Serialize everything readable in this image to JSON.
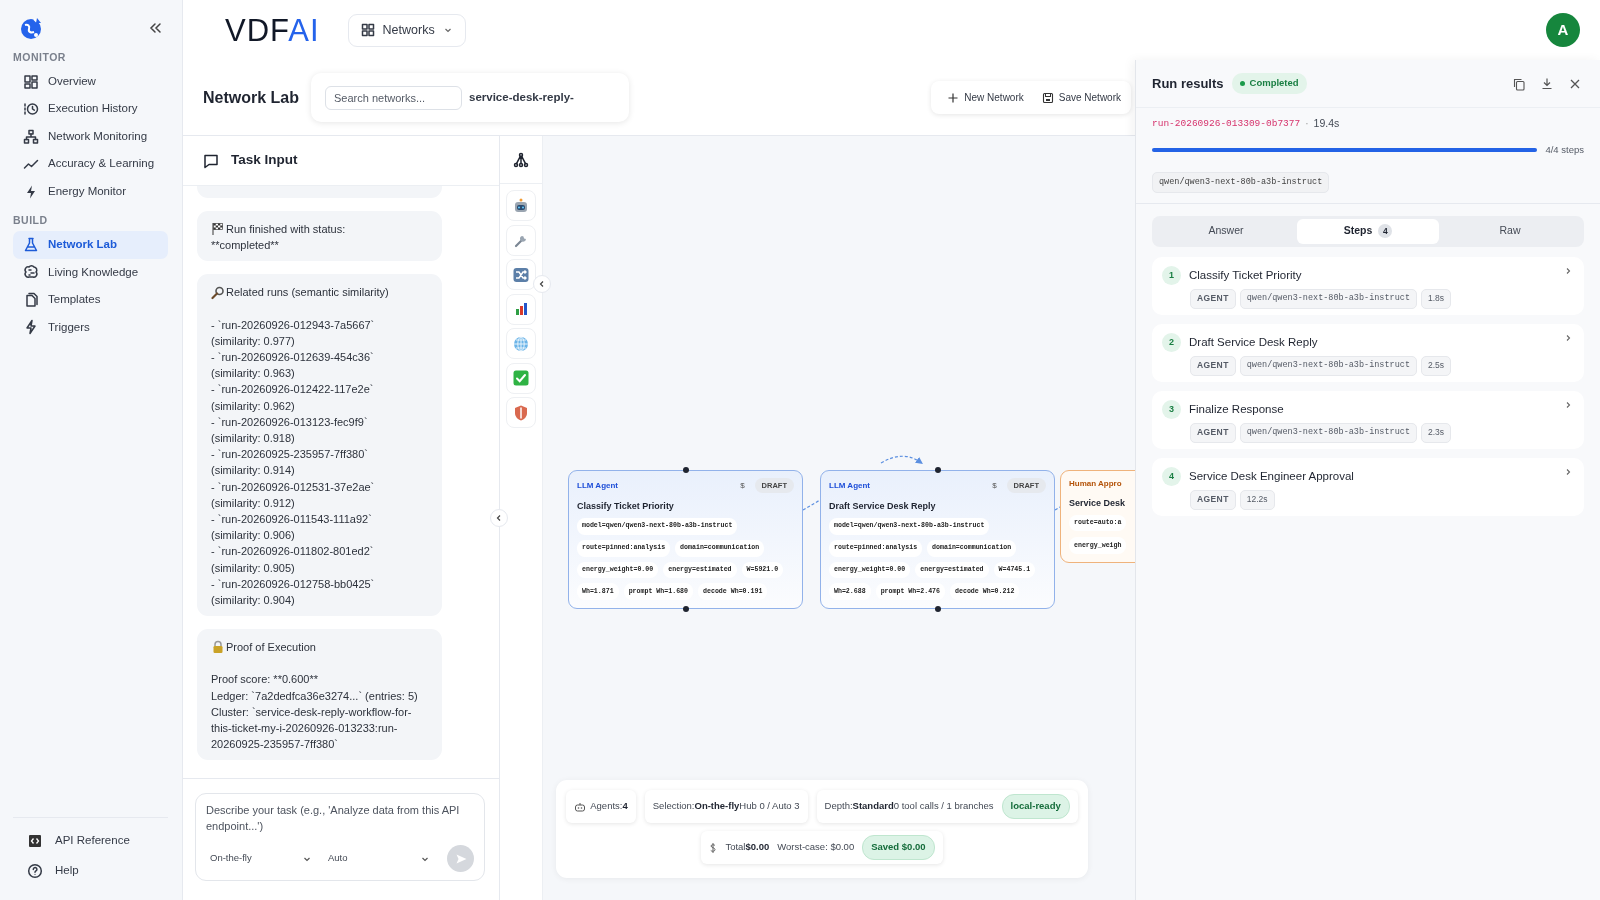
{
  "sidebar": {
    "sections": [
      {
        "label": "MONITOR",
        "items": [
          {
            "label": "Overview",
            "selected": false
          },
          {
            "label": "Execution History",
            "selected": false
          },
          {
            "label": "Network Monitoring",
            "selected": false
          },
          {
            "label": "Accuracy & Learning",
            "selected": false
          },
          {
            "label": "Energy Monitor",
            "selected": false
          }
        ]
      },
      {
        "label": "BUILD",
        "items": [
          {
            "label": "Network Lab",
            "selected": true
          },
          {
            "label": "Living Knowledge",
            "selected": false
          },
          {
            "label": "Templates",
            "selected": false
          },
          {
            "label": "Triggers",
            "selected": false
          }
        ]
      }
    ],
    "footer": [
      {
        "label": "API Reference"
      },
      {
        "label": "Help"
      }
    ]
  },
  "header": {
    "logo": {
      "main": "VDF",
      "accent": "AI"
    },
    "network_menu": "Networks",
    "avatar": "A"
  },
  "page": {
    "title": "Network Lab",
    "search": {
      "placeholder": "Search networks..."
    },
    "network_name": "service-desk-reply-",
    "actions": [
      "New Network",
      "Save Network"
    ]
  },
  "task_input": {
    "title": "Task Input",
    "messages": [
      {
        "kind": "status",
        "title": "Run finished with status:",
        "lines": [
          "**completed**"
        ]
      },
      {
        "kind": "related",
        "title": "Related runs (semantic similarity)",
        "lines": [
          "- `run-20260926-012943-7a5667`",
          "(similarity: 0.977)",
          "- `run-20260926-012639-454c36`",
          "(similarity: 0.963)",
          "- `run-20260926-012422-117e2e`",
          "(similarity: 0.962)",
          "- `run-20260926-013123-fec9f9`",
          "(similarity: 0.918)",
          "- `run-20260925-235957-7ff380`",
          "(similarity: 0.914)",
          "- `run-20260926-012531-37e2ae`",
          "(similarity: 0.912)",
          "- `run-20260926-011543-111a92`",
          "(similarity: 0.906)",
          "- `run-20260926-011802-801ed2`",
          "(similarity: 0.905)",
          "- `run-20260926-012758-bb0425`",
          "(similarity: 0.904)"
        ]
      },
      {
        "kind": "proof",
        "title": "Proof of Execution",
        "lines": [
          "Proof score: **0.600**",
          "Ledger: `7a2dedfca36e3274...` (entries: 5)",
          "Cluster: `service-desk-reply-workflow-for-this-ticket-my-i-20260926-013233:run-20260925-235957-7ff380`"
        ]
      }
    ],
    "composer": {
      "placeholder": "Describe your task (e.g., 'Analyze data from this API endpoint...')",
      "mode": "On-the-fly",
      "model": "Auto",
      "send_disabled": true
    }
  },
  "canvas": {
    "nodes": [
      {
        "kind": "llm",
        "type": "LLM Agent",
        "cost": "$",
        "status": "DRAFT",
        "title": "Classify Ticket Priority",
        "chip_rows": [
          [
            "model=qwen/qwen3-next-80b-a3b-instruct"
          ],
          [
            "route=pinned:analysis",
            "domain=communication"
          ],
          [
            "energy_weight=0.00",
            "energy=estimated",
            "W=5921.0"
          ],
          [
            "Wh=1.871",
            "prompt Wh=1.680",
            "decode Wh=0.191"
          ]
        ]
      },
      {
        "kind": "llm",
        "type": "LLM Agent",
        "cost": "$",
        "status": "DRAFT",
        "title": "Draft Service Desk Reply",
        "chip_rows": [
          [
            "model=qwen/qwen3-next-80b-a3b-instruct"
          ],
          [
            "route=pinned:analysis",
            "domain=communication"
          ],
          [
            "energy_weight=0.00",
            "energy=estimated",
            "W=4745.1"
          ],
          [
            "Wh=2.688",
            "prompt Wh=2.476",
            "decode Wh=0.212"
          ]
        ]
      },
      {
        "kind": "human",
        "type": "Human Appro",
        "title": "Service Desk",
        "chip_rows": [
          [
            "route=auto:a"
          ],
          [
            "energy_weigh"
          ]
        ]
      }
    ],
    "summary": {
      "agents": "Agents:**4**",
      "selection": "Selection:**On-the-fly**Hub 0 / Auto 3",
      "depth": "Depth:**Standard**0 tool calls / 1 branches",
      "readiness": "local-ready",
      "total": "Total**$0.00**",
      "worst_case": "Worst-case: $0.00",
      "saved": "Saved $0.00"
    }
  },
  "results": {
    "title": "Run results",
    "status": "Completed",
    "run_id": "run-20260926-013309-0b7377",
    "separator": "·",
    "duration": "19.4s",
    "progress": {
      "level": 1,
      "label": "4/4 steps"
    },
    "model": "qwen/qwen3-next-80b-a3b-instruct",
    "tabs": [
      {
        "label": "Answer",
        "selected": false
      },
      {
        "label": "Steps",
        "count": "4",
        "selected": true
      },
      {
        "label": "Raw",
        "selected": false
      }
    ],
    "steps": [
      {
        "number": "1",
        "title": "Classify Ticket Priority",
        "tags": [
          "AGENT",
          "qwen/qwen3-next-80b-a3b-instruct",
          "1.8s"
        ]
      },
      {
        "number": "2",
        "title": "Draft Service Desk Reply",
        "tags": [
          "AGENT",
          "qwen/qwen3-next-80b-a3b-instruct",
          "2.5s"
        ]
      },
      {
        "number": "3",
        "title": "Finalize Response",
        "tags": [
          "AGENT",
          "qwen/qwen3-next-80b-a3b-instruct",
          "2.3s"
        ]
      },
      {
        "number": "4",
        "title": "Service Desk Engineer Approval",
        "tags": [
          "AGENT",
          "12.2s"
        ]
      }
    ]
  }
}
